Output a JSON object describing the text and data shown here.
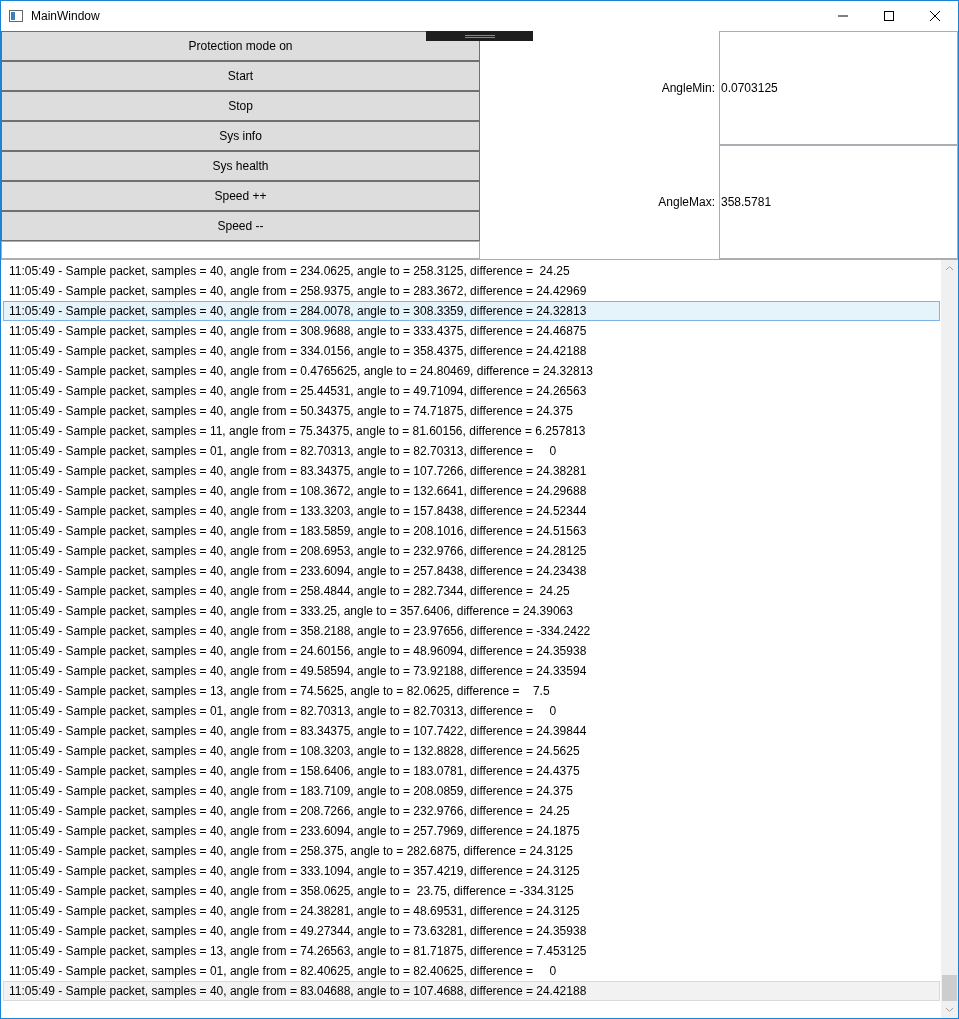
{
  "window": {
    "title": "MainWindow"
  },
  "buttons": [
    "Protection mode on",
    "Start",
    "Stop",
    "Sys info",
    "Sys health",
    "Speed ++",
    "Speed --"
  ],
  "fields": [
    {
      "label": "AngleMin:",
      "value": "0.0703125"
    },
    {
      "label": "AngleMax:",
      "value": "358.5781"
    }
  ],
  "log": [
    {
      "text": "11:05:49 - Sample packet, samples = 40, angle from = 234.0625, angle to = 258.3125, difference =  24.25",
      "selected": false,
      "focused": false
    },
    {
      "text": "11:05:49 - Sample packet, samples = 40, angle from = 258.9375, angle to = 283.3672, difference = 24.42969",
      "selected": false,
      "focused": false
    },
    {
      "text": "11:05:49 - Sample packet, samples = 40, angle from = 284.0078, angle to = 308.3359, difference = 24.32813",
      "selected": true,
      "focused": false
    },
    {
      "text": "11:05:49 - Sample packet, samples = 40, angle from = 308.9688, angle to = 333.4375, difference = 24.46875",
      "selected": false,
      "focused": false
    },
    {
      "text": "11:05:49 - Sample packet, samples = 40, angle from = 334.0156, angle to = 358.4375, difference = 24.42188",
      "selected": false,
      "focused": false
    },
    {
      "text": "11:05:49 - Sample packet, samples = 40, angle from = 0.4765625, angle to = 24.80469, difference = 24.32813",
      "selected": false,
      "focused": false
    },
    {
      "text": "11:05:49 - Sample packet, samples = 40, angle from = 25.44531, angle to = 49.71094, difference = 24.26563",
      "selected": false,
      "focused": false
    },
    {
      "text": "11:05:49 - Sample packet, samples = 40, angle from = 50.34375, angle to = 74.71875, difference = 24.375",
      "selected": false,
      "focused": false
    },
    {
      "text": "11:05:49 - Sample packet, samples = 11, angle from = 75.34375, angle to = 81.60156, difference = 6.257813",
      "selected": false,
      "focused": false
    },
    {
      "text": "11:05:49 - Sample packet, samples = 01, angle from = 82.70313, angle to = 82.70313, difference =     0",
      "selected": false,
      "focused": false
    },
    {
      "text": "11:05:49 - Sample packet, samples = 40, angle from = 83.34375, angle to = 107.7266, difference = 24.38281",
      "selected": false,
      "focused": false
    },
    {
      "text": "11:05:49 - Sample packet, samples = 40, angle from = 108.3672, angle to = 132.6641, difference = 24.29688",
      "selected": false,
      "focused": false
    },
    {
      "text": "11:05:49 - Sample packet, samples = 40, angle from = 133.3203, angle to = 157.8438, difference = 24.52344",
      "selected": false,
      "focused": false
    },
    {
      "text": "11:05:49 - Sample packet, samples = 40, angle from = 183.5859, angle to = 208.1016, difference = 24.51563",
      "selected": false,
      "focused": false
    },
    {
      "text": "11:05:49 - Sample packet, samples = 40, angle from = 208.6953, angle to = 232.9766, difference = 24.28125",
      "selected": false,
      "focused": false
    },
    {
      "text": "11:05:49 - Sample packet, samples = 40, angle from = 233.6094, angle to = 257.8438, difference = 24.23438",
      "selected": false,
      "focused": false
    },
    {
      "text": "11:05:49 - Sample packet, samples = 40, angle from = 258.4844, angle to = 282.7344, difference =  24.25",
      "selected": false,
      "focused": false
    },
    {
      "text": "11:05:49 - Sample packet, samples = 40, angle from = 333.25, angle to = 357.6406, difference = 24.39063",
      "selected": false,
      "focused": false
    },
    {
      "text": "11:05:49 - Sample packet, samples = 40, angle from = 358.2188, angle to = 23.97656, difference = -334.2422",
      "selected": false,
      "focused": false
    },
    {
      "text": "11:05:49 - Sample packet, samples = 40, angle from = 24.60156, angle to = 48.96094, difference = 24.35938",
      "selected": false,
      "focused": false
    },
    {
      "text": "11:05:49 - Sample packet, samples = 40, angle from = 49.58594, angle to = 73.92188, difference = 24.33594",
      "selected": false,
      "focused": false
    },
    {
      "text": "11:05:49 - Sample packet, samples = 13, angle from = 74.5625, angle to = 82.0625, difference =    7.5",
      "selected": false,
      "focused": false
    },
    {
      "text": "11:05:49 - Sample packet, samples = 01, angle from = 82.70313, angle to = 82.70313, difference =     0",
      "selected": false,
      "focused": false
    },
    {
      "text": "11:05:49 - Sample packet, samples = 40, angle from = 83.34375, angle to = 107.7422, difference = 24.39844",
      "selected": false,
      "focused": false
    },
    {
      "text": "11:05:49 - Sample packet, samples = 40, angle from = 108.3203, angle to = 132.8828, difference = 24.5625",
      "selected": false,
      "focused": false
    },
    {
      "text": "11:05:49 - Sample packet, samples = 40, angle from = 158.6406, angle to = 183.0781, difference = 24.4375",
      "selected": false,
      "focused": false
    },
    {
      "text": "11:05:49 - Sample packet, samples = 40, angle from = 183.7109, angle to = 208.0859, difference = 24.375",
      "selected": false,
      "focused": false
    },
    {
      "text": "11:05:49 - Sample packet, samples = 40, angle from = 208.7266, angle to = 232.9766, difference =  24.25",
      "selected": false,
      "focused": false
    },
    {
      "text": "11:05:49 - Sample packet, samples = 40, angle from = 233.6094, angle to = 257.7969, difference = 24.1875",
      "selected": false,
      "focused": false
    },
    {
      "text": "11:05:49 - Sample packet, samples = 40, angle from = 258.375, angle to = 282.6875, difference = 24.3125",
      "selected": false,
      "focused": false
    },
    {
      "text": "11:05:49 - Sample packet, samples = 40, angle from = 333.1094, angle to = 357.4219, difference = 24.3125",
      "selected": false,
      "focused": false
    },
    {
      "text": "11:05:49 - Sample packet, samples = 40, angle from = 358.0625, angle to =  23.75, difference = -334.3125",
      "selected": false,
      "focused": false
    },
    {
      "text": "11:05:49 - Sample packet, samples = 40, angle from = 24.38281, angle to = 48.69531, difference = 24.3125",
      "selected": false,
      "focused": false
    },
    {
      "text": "11:05:49 - Sample packet, samples = 40, angle from = 49.27344, angle to = 73.63281, difference = 24.35938",
      "selected": false,
      "focused": false
    },
    {
      "text": "11:05:49 - Sample packet, samples = 13, angle from = 74.26563, angle to = 81.71875, difference = 7.453125",
      "selected": false,
      "focused": false
    },
    {
      "text": "11:05:49 - Sample packet, samples = 01, angle from = 82.40625, angle to = 82.40625, difference =     0",
      "selected": false,
      "focused": false
    },
    {
      "text": "11:05:49 - Sample packet, samples = 40, angle from = 83.04688, angle to = 107.4688, difference = 24.42188",
      "selected": false,
      "focused": true
    }
  ]
}
